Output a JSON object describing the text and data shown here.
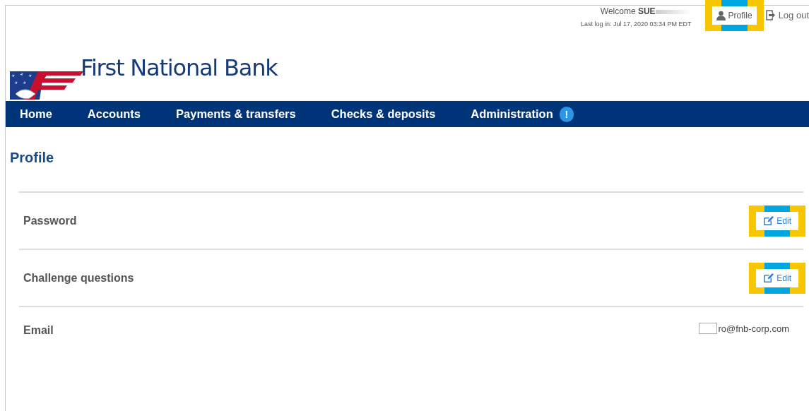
{
  "header": {
    "welcome": "Welcome",
    "user": "SUE",
    "last_login": "Last log in: Jul 17, 2020 03:34 PM EDT",
    "profile_button": {
      "label": "Profile",
      "highlighted": true
    },
    "logout_button": {
      "label": "Log out"
    }
  },
  "logo": {
    "name": "First National Bank"
  },
  "nav": [
    {
      "label": "Home",
      "alert": false
    },
    {
      "label": "Accounts",
      "alert": false
    },
    {
      "label": "Payments & transfers",
      "alert": false
    },
    {
      "label": "Checks & deposits",
      "alert": false
    },
    {
      "label": "Administration",
      "alert": true
    }
  ],
  "alert_badge": "!",
  "page_title": "Profile",
  "rows": [
    {
      "kind": "edit",
      "label": "Password",
      "button": "Edit",
      "highlighted": true
    },
    {
      "kind": "edit",
      "label": "Challenge questions",
      "button": "Edit",
      "highlighted": true
    },
    {
      "kind": "value",
      "label": "Email",
      "value": "ro@fnb-corp.com",
      "redacted": true
    }
  ]
}
